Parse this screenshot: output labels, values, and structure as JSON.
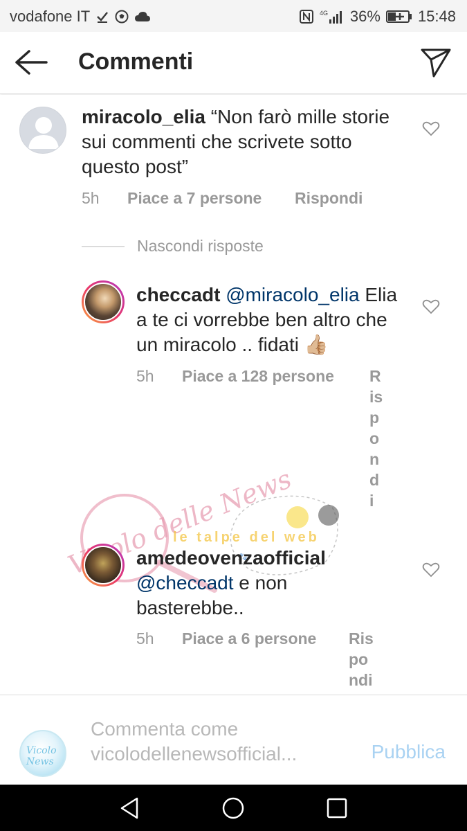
{
  "status_bar": {
    "carrier": "vodafone IT",
    "network": "4G",
    "battery": "36%",
    "time": "15:48"
  },
  "header": {
    "title": "Commenti",
    "back_icon": "arrow-left-icon",
    "send_icon": "paper-plane-icon"
  },
  "comments": [
    {
      "username": "miracolo_elia",
      "text": "“Non farò mille storie sui commenti che scrivete sotto questo post”",
      "time": "5h",
      "likes": "Piace a 7 persone",
      "reply": "Rispondi"
    }
  ],
  "hide_replies": "Nascondi risposte",
  "replies": [
    {
      "username": "checcadt",
      "mention": "@miracolo_elia",
      "text": "Elia a te ci vorrebbe ben altro che un miracolo .. fidati 👍🏼",
      "time": "5h",
      "likes": "Piace a 128 persone",
      "reply": "Rispondi"
    },
    {
      "username": "amedeovenzaofficial",
      "mention": "@checcadt",
      "text": " e non basterebbe..",
      "time": "5h",
      "likes": "Piace a 6 persone",
      "reply": "Rispondi"
    }
  ],
  "watermark": {
    "logo_text": "Vicolo delle News",
    "banner_text": "le talpe del web"
  },
  "composer": {
    "placeholder": "Commenta come vicolodellenewsofficial...",
    "publish_label": "Pubblica",
    "avatar_text": "Vicolo News"
  },
  "colors": {
    "link": "#003569",
    "meta": "#999999",
    "publish": "#a9d2f2",
    "placeholder": "#b8b8b8"
  }
}
